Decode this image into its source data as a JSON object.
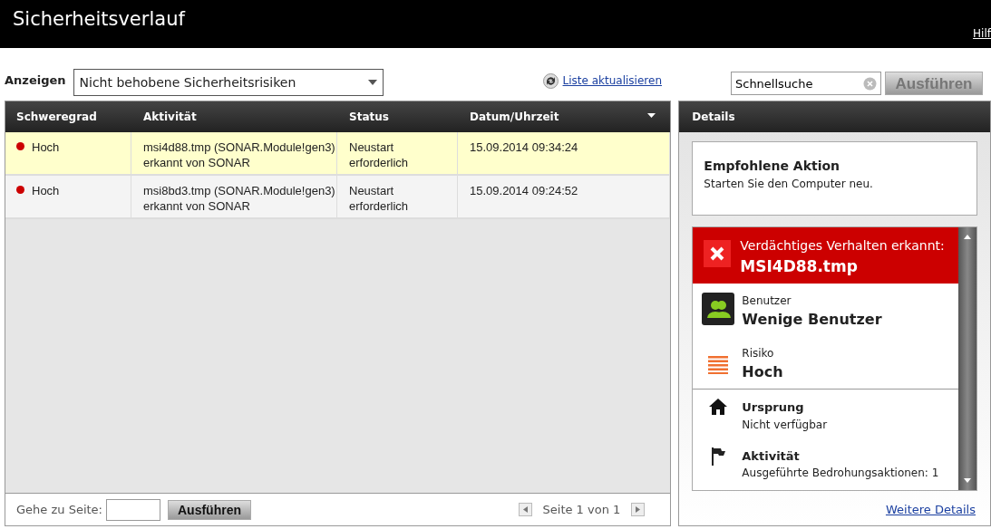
{
  "window": {
    "title": "Sicherheitsverlauf",
    "help_link": "Hilf"
  },
  "filter": {
    "label": "Anzeigen",
    "value": "Nicht behobene Sicherheitsrisiken"
  },
  "refresh_link": "Liste aktualisieren",
  "search": {
    "value": "Schnellsuche",
    "button": "Ausführen",
    "button_disabled": true
  },
  "table": {
    "columns": [
      "Schweregrad",
      "Aktivität",
      "Status",
      "Datum/Uhrzeit"
    ],
    "rows": [
      {
        "severity": "Hoch",
        "color": "#cc0000",
        "activity": "msi4d88.tmp (SONAR.Module!gen3) erkannt von SONAR",
        "status": "Neustart erforderlich",
        "datetime": "15.09.2014 09:34:24",
        "selected": true
      },
      {
        "severity": "Hoch",
        "color": "#cc0000",
        "activity": "msi8bd3.tmp (SONAR.Module!gen3) erkannt von SONAR",
        "status": "Neustart erforderlich",
        "datetime": "15.09.2014 09:24:52",
        "selected": false
      }
    ]
  },
  "pager": {
    "goto_label": "Gehe zu Seite:",
    "goto_button": "Ausführen",
    "page_text": "Seite 1 von 1"
  },
  "details": {
    "title": "Details",
    "recommended": {
      "title": "Empfohlene Aktion",
      "text": "Starten Sie den Computer neu."
    },
    "alert": {
      "label": "Verdächtiges Verhalten erkannt:",
      "file": "MSI4D88.tmp"
    },
    "items": [
      {
        "kind": "users",
        "label": "Benutzer",
        "value": "Wenige Benutzer"
      },
      {
        "kind": "risk",
        "label": "Risiko",
        "value": "Hoch"
      },
      {
        "kind": "origin",
        "label": "Ursprung",
        "value": "Nicht verfügbar"
      },
      {
        "kind": "activity",
        "label": "Aktivität",
        "value": "Ausgeführte Bedrohungsaktionen: 1"
      }
    ],
    "more_link": "Weitere Details"
  }
}
